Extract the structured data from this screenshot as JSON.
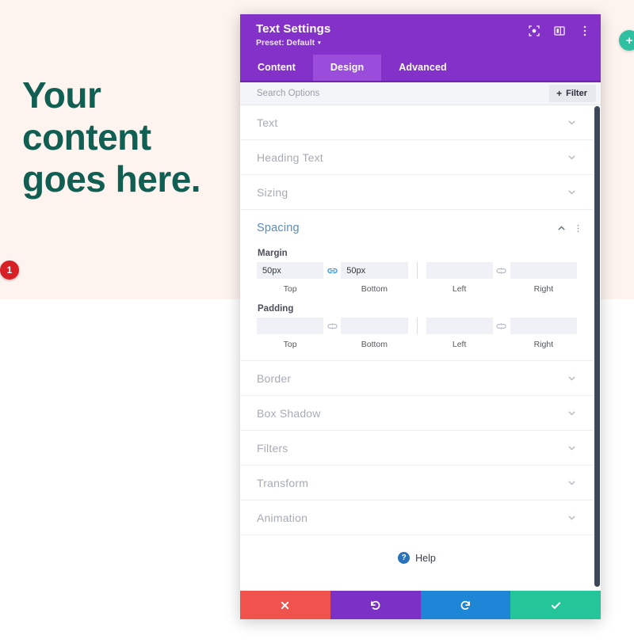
{
  "page": {
    "hero_text": "Your content goes here.",
    "hero_color": "#115f53",
    "hero_bg": "#fdf3ef",
    "add_button_label": "+"
  },
  "modal": {
    "title": "Text Settings",
    "preset": "Preset: Default",
    "preset_caret": "▾",
    "header_icons": [
      {
        "name": "focus-target-icon"
      },
      {
        "name": "panel-layout-icon"
      },
      {
        "name": "more-options-icon"
      }
    ],
    "tabs": [
      {
        "label": "Content",
        "active": false
      },
      {
        "label": "Design",
        "active": true
      },
      {
        "label": "Advanced",
        "active": false
      }
    ],
    "search": {
      "placeholder": "Search Options",
      "value": "",
      "filter_label": "Filter",
      "filter_plus": "+"
    },
    "sections_above": [
      {
        "label": "Text"
      },
      {
        "label": "Heading Text"
      },
      {
        "label": "Sizing"
      }
    ],
    "spacing": {
      "title": "Spacing",
      "accent_color": "#5b8dba",
      "margin": {
        "label": "Margin",
        "fields": [
          {
            "caption": "Top",
            "value": "50px",
            "placeholder": ""
          },
          {
            "caption": "Bottom",
            "value": "50px",
            "placeholder": ""
          },
          {
            "caption": "Left",
            "value": "",
            "placeholder": ""
          },
          {
            "caption": "Right",
            "value": "",
            "placeholder": ""
          }
        ],
        "link_left_state": "linked",
        "link_right_state": "unlinked"
      },
      "padding": {
        "label": "Padding",
        "fields": [
          {
            "caption": "Top",
            "value": "",
            "placeholder": ""
          },
          {
            "caption": "Bottom",
            "value": "",
            "placeholder": ""
          },
          {
            "caption": "Left",
            "value": "",
            "placeholder": ""
          },
          {
            "caption": "Right",
            "value": "",
            "placeholder": ""
          }
        ],
        "link_left_state": "unlinked",
        "link_right_state": "unlinked"
      }
    },
    "sections_below": [
      {
        "label": "Border"
      },
      {
        "label": "Box Shadow"
      },
      {
        "label": "Filters"
      },
      {
        "label": "Transform"
      },
      {
        "label": "Animation"
      }
    ],
    "help": {
      "icon_glyph": "?",
      "label": "Help"
    },
    "footer": [
      {
        "name": "cancel-button",
        "color": "#f0524d",
        "icon": "close-icon"
      },
      {
        "name": "undo-button",
        "color": "#7b30c6",
        "icon": "undo-icon"
      },
      {
        "name": "redo-button",
        "color": "#1d86d6",
        "icon": "redo-icon"
      },
      {
        "name": "save-button",
        "color": "#25c59a",
        "icon": "check-icon"
      }
    ]
  },
  "annotation": {
    "step_number": "1",
    "color": "#d81f25"
  }
}
